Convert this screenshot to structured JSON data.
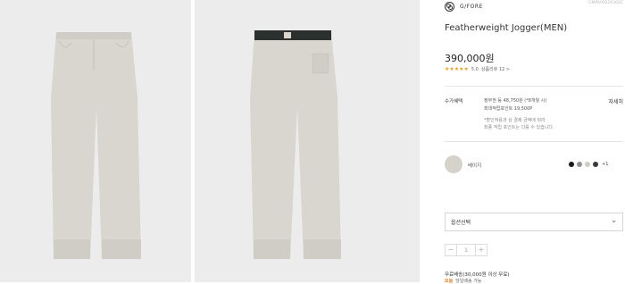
{
  "product": {
    "brand": "G/FORE",
    "code": "GMPA09226360C",
    "title": "Featherweight Jogger(MEN)",
    "price": "390,000원",
    "rating_score": "5.0",
    "rating_stars": "★★★★★",
    "review_count": "상품리뷰 12 >"
  },
  "benefits": {
    "label": "수가혜택",
    "line1": "정부권 등 48,750원 (*8개월 시)",
    "line2": "최대적립포인트 19,500P",
    "note1": "*할인적용과 상 결제 금액에 따라",
    "note2": "최종 적립 포인트는 다를 수 있습니다.",
    "detail_link": "자세히"
  },
  "colors": {
    "selected_name": "베이지",
    "selected_hex": "#d4d2ca",
    "dots": [
      "#1a1a1a",
      "#8f8f8f",
      "#cfcdc4",
      "#3a3a3a"
    ],
    "more": "+1"
  },
  "option_select": {
    "label": "옵션선택"
  },
  "quantity": {
    "minus": "−",
    "value": "1",
    "plus": "+"
  },
  "shipping": {
    "text": "무료배송(30,000원 이상 무료)",
    "delivery_badge": "오늘",
    "delivery_text": "당일배송 가능"
  }
}
